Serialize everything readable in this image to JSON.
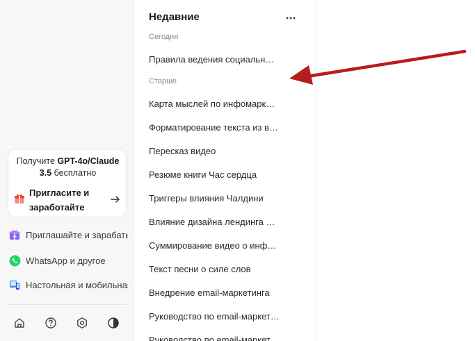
{
  "promo": {
    "text_pre": "Получите ",
    "text_bold": "GPT-4o/Claude 3.5",
    "text_post": " бесплатно",
    "invite_label": "Пригласите и заработайте"
  },
  "sidebar": {
    "items": [
      {
        "label": "Приглашайте и зарабатывайте"
      },
      {
        "label": "WhatsApp и другое"
      },
      {
        "label": "Настольная и мобильная"
      }
    ]
  },
  "history": {
    "title": "Недавние",
    "sections": [
      {
        "label": "Сегодня",
        "items": [
          "Правила ведения социальных сетей"
        ]
      },
      {
        "label": "Старше",
        "items": [
          "Карта мыслей по инфомаркетингу",
          "Форматирование текста из видео",
          "Пересказ видео",
          "Резюме книги Час сердца",
          "Триггеры влияния Чалдини",
          "Влияние дизайна лендинга на конверсию",
          "Суммирование видео о инфобизнесе",
          "Текст песни о силе слов",
          "Внедрение email-маркетинга",
          "Руководство по email-маркетингу",
          "Руководство по email-маркетингу"
        ]
      }
    ]
  },
  "colors": {
    "accent_red": "#b71c1c",
    "whatsapp": "#25d366",
    "invite_purple": "#8b5cf6"
  },
  "icons": [
    "gift-icon",
    "arrow-right-icon",
    "invite-icon",
    "whatsapp-icon",
    "devices-icon",
    "home-icon",
    "help-icon",
    "settings-icon",
    "theme-icon",
    "more-icon"
  ]
}
